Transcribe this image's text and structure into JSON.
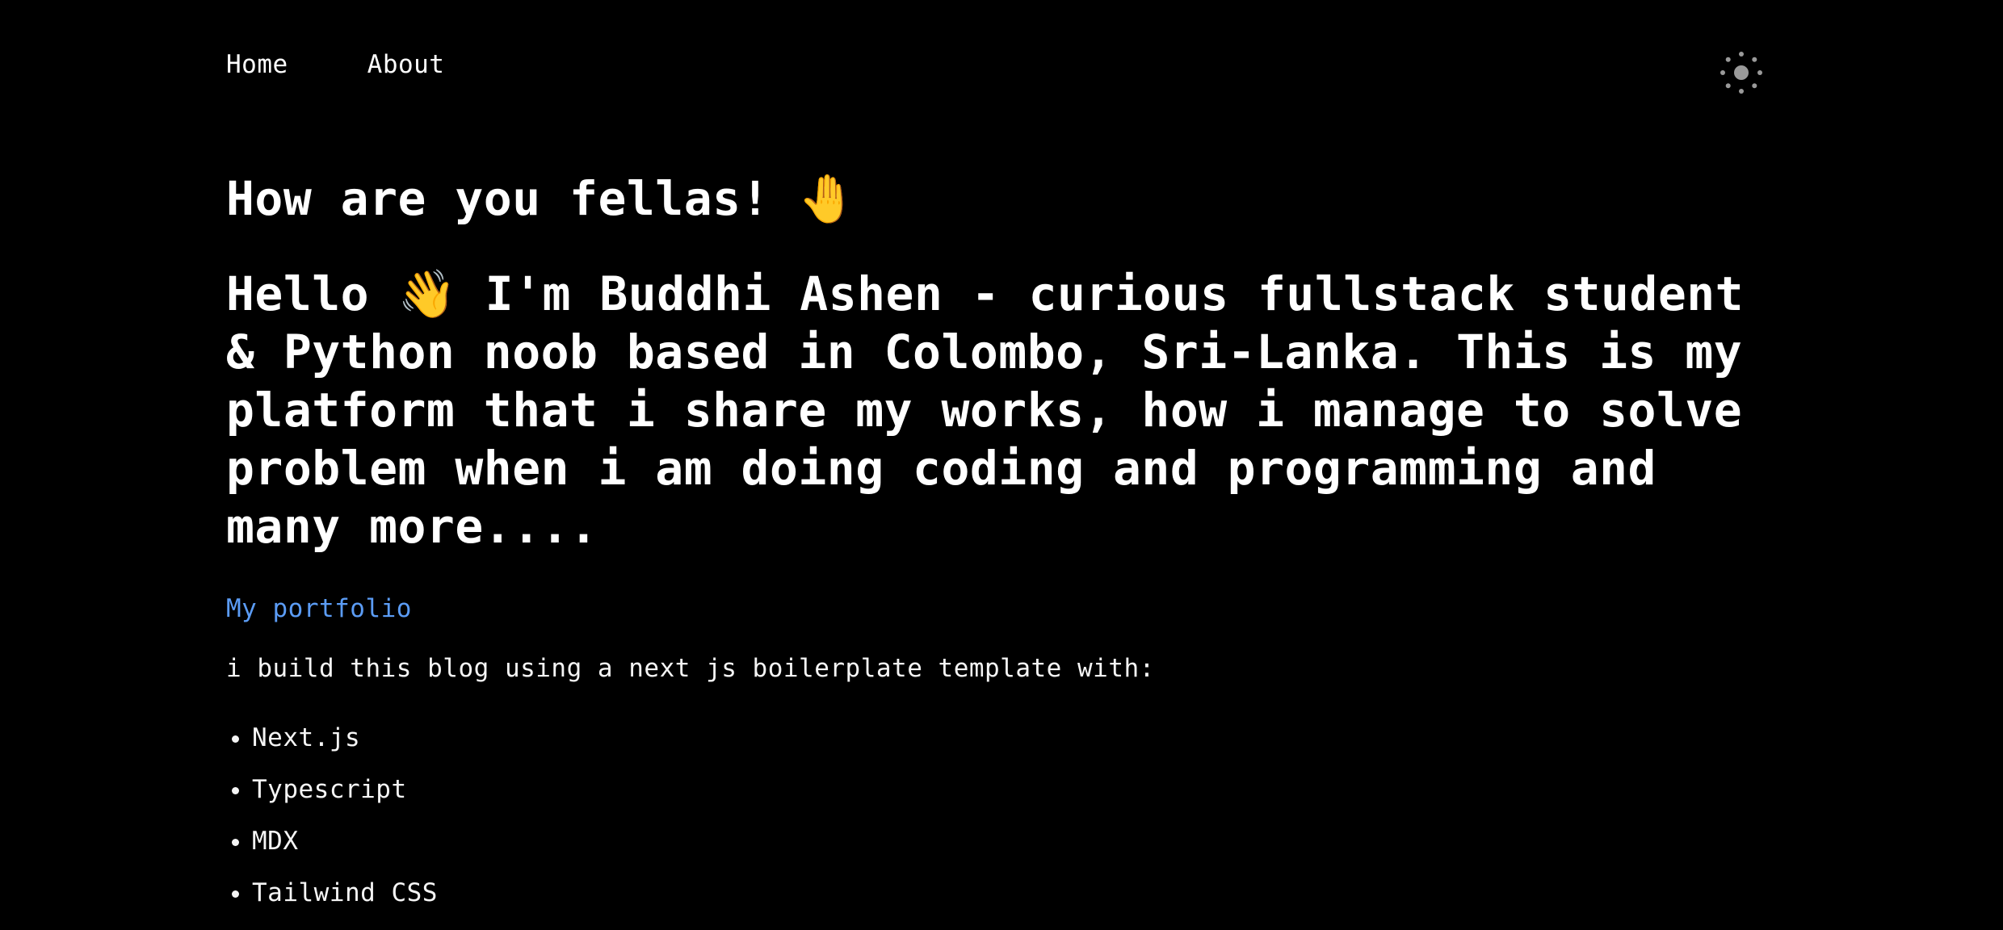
{
  "nav": {
    "home": "Home",
    "about": "About",
    "theme_icon": "sun-icon"
  },
  "hero": {
    "greeting": "How are you fellas!",
    "greeting_emoji": "🤚",
    "intro_hello": "Hello",
    "intro_emoji": "👋",
    "intro_text": "I'm Buddhi Ashen - curious fullstack student & Python noob based in Colombo, Sri-Lanka. This is my platform that i share my works, how i manage to solve problem when i am doing coding and programming and many more...."
  },
  "portfolio_link": "My portfolio",
  "built_with": "i build this blog using a next js boilerplate template with:",
  "tech_stack": [
    "Next.js",
    "Typescript",
    "MDX",
    "Tailwind CSS"
  ],
  "colors": {
    "background": "#000000",
    "text": "#ffffff",
    "link": "#5b9cf5",
    "icon": "#9a9a9a"
  }
}
